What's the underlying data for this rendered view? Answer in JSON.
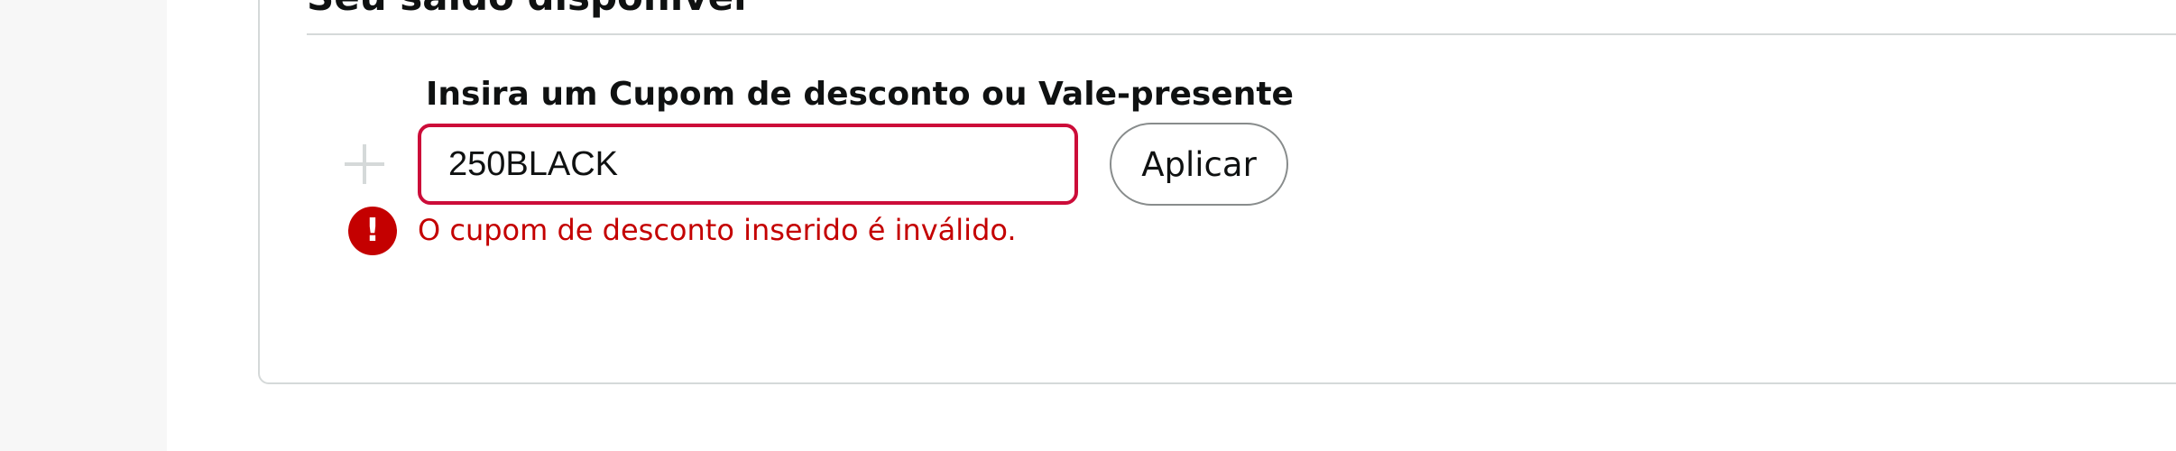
{
  "coupon_section": {
    "title": "Seu saldo disponível",
    "label": "Insira um Cupom de desconto ou Vale-presente",
    "input_value": "250BLACK",
    "apply_label": "Aplicar",
    "error_message": "O cupom de desconto inserido é inválido.",
    "error_icon_glyph": "!"
  },
  "icons": {
    "add": "plus-icon",
    "error": "error-icon"
  },
  "colors": {
    "error": "#c40000",
    "input_error_border": "#cc0c39",
    "text": "#0f1111",
    "border": "#d5d9d9",
    "gutter": "#f7f7f7"
  }
}
